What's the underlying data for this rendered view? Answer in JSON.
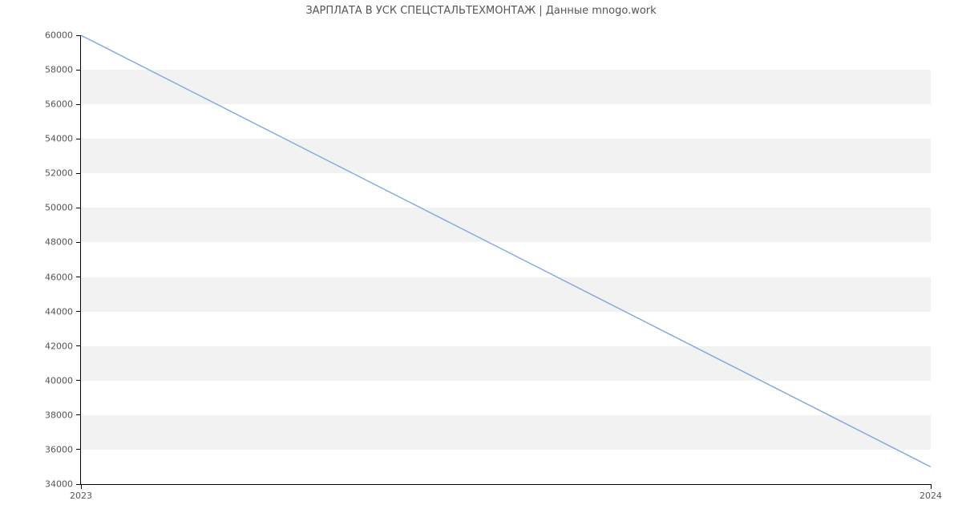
{
  "chart_data": {
    "type": "line",
    "title": "ЗАРПЛАТА В УСК СПЕЦСТАЛЬТЕХМОНТАЖ | Данные mnogo.work",
    "xlabel": "",
    "ylabel": "",
    "x": [
      2023,
      2024
    ],
    "values": [
      60000,
      35000
    ],
    "x_ticks": [
      2023,
      2024
    ],
    "y_ticks": [
      34000,
      36000,
      38000,
      40000,
      42000,
      44000,
      46000,
      48000,
      50000,
      52000,
      54000,
      56000,
      58000,
      60000
    ],
    "xlim": [
      2023,
      2024
    ],
    "ylim": [
      34000,
      60000
    ],
    "line_color": "#7fa6e0",
    "band_color": "#f2f2f2"
  }
}
